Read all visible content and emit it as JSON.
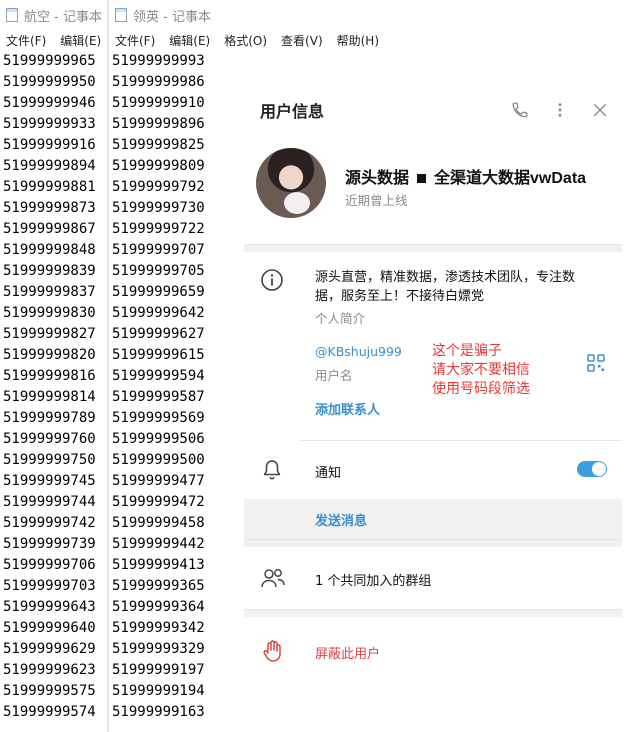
{
  "left_window": {
    "title": "航空 - 记事本",
    "menu": [
      "文件(F)",
      "编辑(E)"
    ],
    "lines": [
      "51999999965",
      "51999999950",
      "51999999946",
      "51999999933",
      "51999999916",
      "51999999894",
      "51999999881",
      "51999999873",
      "51999999867",
      "51999999848",
      "51999999839",
      "51999999837",
      "51999999830",
      "51999999827",
      "51999999820",
      "51999999816",
      "51999999814",
      "51999999789",
      "51999999760",
      "51999999750",
      "51999999745",
      "51999999744",
      "51999999742",
      "51999999739",
      "51999999706",
      "51999999703",
      "51999999643",
      "51999999640",
      "51999999629",
      "51999999623",
      "51999999575",
      "51999999574"
    ]
  },
  "right_window": {
    "title": "领英 - 记事本",
    "menu": [
      "文件(F)",
      "编辑(E)",
      "格式(O)",
      "查看(V)",
      "帮助(H)"
    ],
    "lines": [
      "51999999993",
      "51999999986",
      "51999999910",
      "51999999896",
      "51999999825",
      "51999999809",
      "51999999792",
      "51999999730",
      "51999999722",
      "51999999707",
      "51999999705",
      "51999999659",
      "51999999642",
      "51999999627",
      "51999999615",
      "51999999594",
      "51999999587",
      "51999999569",
      "51999999506",
      "51999999500",
      "51999999477",
      "51999999472",
      "51999999458",
      "51999999442",
      "51999999413",
      "51999999365",
      "51999999364",
      "51999999342",
      "51999999329",
      "51999999197",
      "51999999194",
      "51999999163"
    ]
  },
  "panel": {
    "title": "用户信息",
    "header_icons": [
      "phone-icon",
      "more-vertical-icon",
      "close-icon"
    ],
    "name_part1": "源头数据",
    "name_part2": "全渠道大数据vwData",
    "status": "近期曾上线",
    "bio": "源头直营，精准数据，渗透技术团队，专注数据，服务至上！不接待白嫖党",
    "bio_label": "个人简介",
    "username": "@KBshuju999",
    "username_label": "用户名",
    "warning": [
      "这个是骗子",
      "请大家不要相信",
      "使用号码段筛选"
    ],
    "add_contact": "添加联系人",
    "notifications_label": "通知",
    "notifications_on": true,
    "send_message": "发送消息",
    "groups_label": "1 个共同加入的群组",
    "block_label": "屏蔽此用户",
    "colors": {
      "accent": "#3a8fd0",
      "warning": "#e53935",
      "danger": "#d44444",
      "toggle": "#3a9ee0"
    }
  }
}
